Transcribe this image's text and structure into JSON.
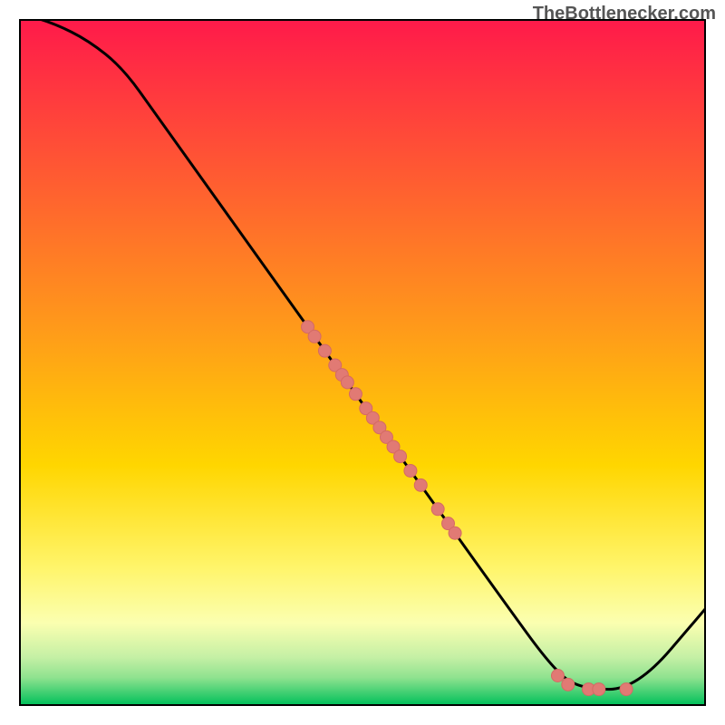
{
  "watermark": "TheBottlenecker.com",
  "colors": {
    "curve": "#000000",
    "dot_fill": "#e17a74",
    "dot_stroke": "#d46a64",
    "top_grad": "#ff1a4a",
    "mid_grad": "#ffd600",
    "band_pale": "#fbffb0",
    "band_green_light": "#8fe28f",
    "bottom_green": "#00c05a"
  },
  "chart_data": {
    "type": "line",
    "title": "",
    "xlabel": "",
    "ylabel": "",
    "xlim": [
      0,
      100
    ],
    "ylim": [
      0,
      100
    ],
    "curve": [
      {
        "x": 0,
        "y": 101
      },
      {
        "x": 5,
        "y": 99.5
      },
      {
        "x": 10,
        "y": 97
      },
      {
        "x": 15,
        "y": 93
      },
      {
        "x": 20,
        "y": 86
      },
      {
        "x": 30,
        "y": 72
      },
      {
        "x": 40,
        "y": 58
      },
      {
        "x": 50,
        "y": 44
      },
      {
        "x": 60,
        "y": 30
      },
      {
        "x": 70,
        "y": 16
      },
      {
        "x": 78,
        "y": 5
      },
      {
        "x": 82,
        "y": 2.3
      },
      {
        "x": 90,
        "y": 2.3
      },
      {
        "x": 100,
        "y": 14
      }
    ],
    "dots_on_slope": [
      {
        "x": 42.0,
        "y": 55.2
      },
      {
        "x": 43.0,
        "y": 53.8
      },
      {
        "x": 44.5,
        "y": 51.7
      },
      {
        "x": 46.0,
        "y": 49.6
      },
      {
        "x": 47.0,
        "y": 48.2
      },
      {
        "x": 47.8,
        "y": 47.1
      },
      {
        "x": 49.0,
        "y": 45.4
      },
      {
        "x": 50.5,
        "y": 43.3
      },
      {
        "x": 51.5,
        "y": 41.9
      },
      {
        "x": 52.5,
        "y": 40.5
      },
      {
        "x": 53.5,
        "y": 39.1
      },
      {
        "x": 54.5,
        "y": 37.7
      },
      {
        "x": 55.5,
        "y": 36.3
      },
      {
        "x": 57.0,
        "y": 34.2
      },
      {
        "x": 58.5,
        "y": 32.1
      },
      {
        "x": 61.0,
        "y": 28.6
      },
      {
        "x": 62.5,
        "y": 26.5
      },
      {
        "x": 63.5,
        "y": 25.1
      }
    ],
    "dots_at_bottom": [
      {
        "x": 78.5,
        "y": 4.3
      },
      {
        "x": 80.0,
        "y": 3.0
      },
      {
        "x": 83.0,
        "y": 2.3
      },
      {
        "x": 84.5,
        "y": 2.3
      },
      {
        "x": 88.5,
        "y": 2.3
      }
    ],
    "dot_radius_px": 7
  }
}
